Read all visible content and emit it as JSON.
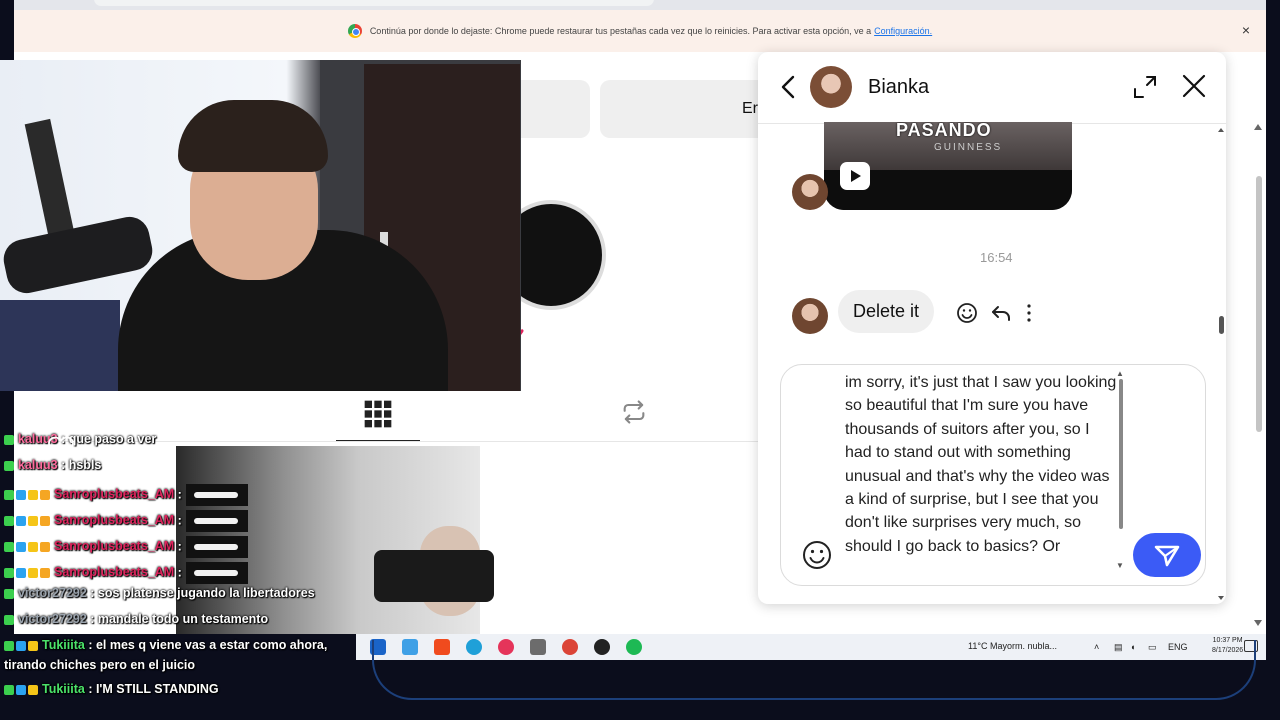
{
  "browser": {
    "infobar": {
      "message": "Continúa por donde lo dejaste: Chrome puede restaurar tus pestañas cada vez que lo reinicies. Para activar esta opción, ve a",
      "link": "Configuración.",
      "close": "×"
    }
  },
  "profile": {
    "button_label": "Er"
  },
  "dm": {
    "contact_name": "Bianka",
    "video_overlay_text": "PASANDO",
    "video_sub_text": "GUINNESS",
    "time": "16:54",
    "message": "Delete it",
    "composer_text": "im sorry, it's just that I saw you looking so beautiful that I'm sure you have thousands of suitors after you, so I had to stand out with something unusual and that's why the video was a kind of surprise, but I see that you don't like surprises very much, so should I go back to basics? Or"
  },
  "chat": [
    {
      "user": "kaluu3",
      "text": ": que paso a ver",
      "color": "#ff6b9d",
      "badges": [
        "#3ccf4e"
      ]
    },
    {
      "user": "kaluu3",
      "text": ": hsbls",
      "color": "#ff6b9d",
      "badges": [
        "#3ccf4e"
      ]
    },
    {
      "user": "Sanroplusbeats_AM",
      "text": ":",
      "color": "#e0245e",
      "badges": [
        "#3ccf4e",
        "#2ba3f0",
        "#f5c518",
        "#f5a623"
      ],
      "emote": true
    },
    {
      "user": "Sanroplusbeats_AM",
      "text": ":",
      "color": "#e0245e",
      "badges": [
        "#3ccf4e",
        "#2ba3f0",
        "#f5c518",
        "#f5a623"
      ],
      "emote": true
    },
    {
      "user": "Sanroplusbeats_AM",
      "text": ":",
      "color": "#e0245e",
      "badges": [
        "#3ccf4e",
        "#2ba3f0",
        "#f5c518",
        "#f5a623"
      ],
      "emote": true
    },
    {
      "user": "Sanroplusbeats_AM",
      "text": ":",
      "color": "#e0245e",
      "badges": [
        "#3ccf4e",
        "#2ba3f0",
        "#f5c518",
        "#f5a623"
      ],
      "emote": true
    },
    {
      "user": "victor27292",
      "text": ": sos platense jugando la libertadores",
      "color": "#9aa3ad",
      "badges": [
        "#3ccf4e"
      ]
    },
    {
      "user": "victor27292",
      "text": ": mandale todo un testamento",
      "color": "#9aa3ad",
      "badges": [
        "#3ccf4e"
      ]
    },
    {
      "user": "Tukiiita",
      "text": ": el mes q viene vas a estar como ahora,",
      "color": "#4be36a",
      "badges": [
        "#3ccf4e",
        "#2ba3f0",
        "#f5c518"
      ]
    },
    {
      "user": "",
      "text": "tirando chiches pero en el juicio",
      "color": "#ffffff",
      "badges": []
    },
    {
      "user": "Tukiiita",
      "text": ": I'M STILL STANDING",
      "color": "#4be36a",
      "badges": [
        "#3ccf4e",
        "#2ba3f0",
        "#f5c518"
      ]
    }
  ],
  "taskbar": {
    "weather": "11°C  Mayorm. nubla...",
    "lang": "ENG",
    "time": "10:37 PM",
    "date": "8/17/2026",
    "icons": [
      {
        "name": "store-icon",
        "color": "#1a64c8"
      },
      {
        "name": "photos-icon",
        "color": "#3fa0e6"
      },
      {
        "name": "brave-icon",
        "color": "#f04b1e"
      },
      {
        "name": "edge-icon",
        "color": "#1fa0d8"
      },
      {
        "name": "app-red-icon",
        "color": "#e5345a"
      },
      {
        "name": "capture-icon",
        "color": "#6c6c6c"
      },
      {
        "name": "chrome-icon",
        "color": "#db4437"
      },
      {
        "name": "obs-icon",
        "color": "#222222"
      },
      {
        "name": "spotify-icon",
        "color": "#1db954"
      }
    ]
  },
  "colors": {
    "send_button": "#3b5bf6",
    "bubble": "#efefef"
  }
}
